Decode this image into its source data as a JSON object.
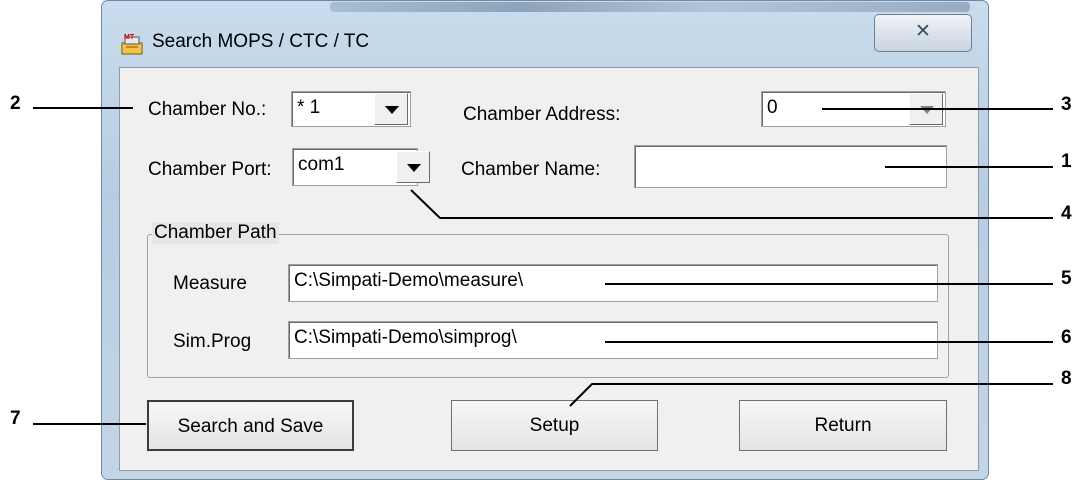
{
  "window": {
    "title": "Search MOPS / CTC / TC",
    "close_glyph": "✕"
  },
  "form": {
    "chamber_no_label": "Chamber No.:",
    "chamber_no_value": "* 1",
    "chamber_address_label": "Chamber Address:",
    "chamber_address_value": "0",
    "chamber_port_label": "Chamber Port:",
    "chamber_port_value": "com1",
    "chamber_name_label": "Chamber Name:",
    "chamber_name_value": ""
  },
  "chamber_path": {
    "group_title": "Chamber Path",
    "measure_label": "Measure",
    "measure_value": "C:\\Simpati-Demo\\measure\\",
    "simprog_label": "Sim.Prog",
    "simprog_value": "C:\\Simpati-Demo\\simprog\\"
  },
  "buttons": {
    "search_save": "Search and Save",
    "setup": "Setup",
    "return": "Return"
  },
  "callouts": {
    "n1": "1",
    "n2": "2",
    "n3": "3",
    "n4": "4",
    "n5": "5",
    "n6": "6",
    "n7": "7",
    "n8": "8"
  },
  "icons": {
    "app": "app-icon",
    "dropdown": "chevron-down-icon",
    "close": "close-icon"
  }
}
